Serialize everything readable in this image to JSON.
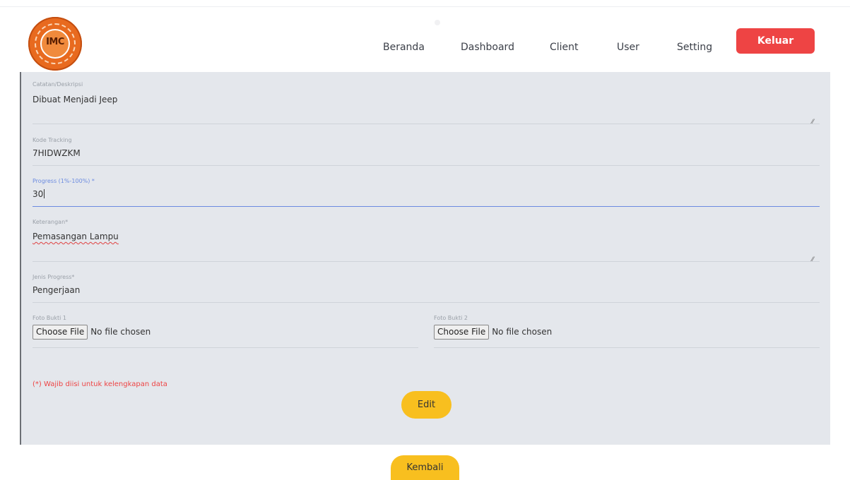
{
  "header": {
    "logo_text": "IMC",
    "nav": [
      "Beranda",
      "Dashboard",
      "Client",
      "User",
      "Setting"
    ],
    "logout_label": "Keluar"
  },
  "form": {
    "catatan": {
      "label": "Catatan/Deskripsi",
      "value": "Dibuat Menjadi Jeep"
    },
    "kode": {
      "label": "Kode Tracking",
      "value": "7HIDWZKM"
    },
    "progress": {
      "label": "Progress (1%-100%) *",
      "value": "30"
    },
    "keterangan": {
      "label": "Keterangan*",
      "value": "Pemasangan Lampu"
    },
    "jenis": {
      "label": "Jenis Progress*",
      "value": "Pengerjaan"
    },
    "foto1": {
      "label": "Foto Bukti 1",
      "button": "Choose File",
      "status": "No file chosen"
    },
    "foto2": {
      "label": "Foto Bukti 2",
      "button": "Choose File",
      "status": "No file chosen"
    },
    "required_note": "(*) Wajib diisi untuk kelengkapan data",
    "edit_label": "Edit"
  },
  "back_label": "Kembali",
  "colors": {
    "logout": "#ee4444",
    "primary_button": "#f8bf1f",
    "panel": "#e4e7ec",
    "focus_line": "#6b8be0"
  }
}
